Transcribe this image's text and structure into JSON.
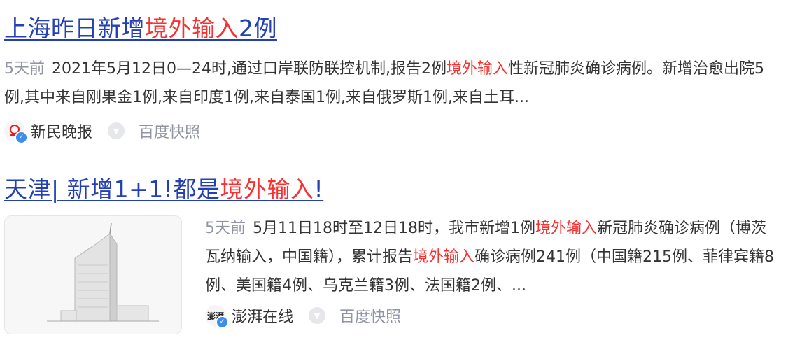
{
  "results": [
    {
      "title_prefix": "上海昨日新增",
      "title_highlight": "境外输入",
      "title_suffix": "2例",
      "age": "5天前",
      "text_1": "2021年5月12日0—24时,通过口岸联防联控机制,报告2例",
      "text_highlight": "境外输入",
      "text_2": "性新冠肺炎确诊病例。新增治愈出院5例,其中来自刚果金1例,来自印度1例,来自泰国1例,来自俄罗斯1例,来自土耳...",
      "source": "新民晚报",
      "snapshot": "百度快照"
    },
    {
      "title_prefix": "天津| 新增1+1!都是",
      "title_highlight": "境外输入",
      "title_suffix": "!",
      "age": "5天前",
      "text_1": "5月11日18时至12日18时，我市新增1例",
      "text_highlight": "境外输入",
      "text_2": "新冠肺炎确诊病例（博茨瓦纳输入，中国籍），累计报告",
      "text_highlight_2": "境外输入",
      "text_3": "确诊病例241例（中国籍215例、菲律宾籍8例、美国籍4例、乌克兰籍3例、法国籍2例、...",
      "source": "澎湃在线",
      "snapshot": "百度快照"
    }
  ]
}
